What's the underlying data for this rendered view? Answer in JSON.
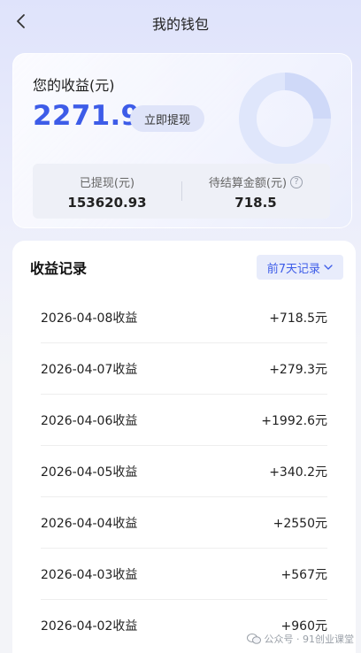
{
  "header": {
    "title": "我的钱包"
  },
  "earnings": {
    "label": "您的收益(元)",
    "amount": "2271.9",
    "withdraw_label": "立即提现",
    "withdrawn_label": "已提现(元)",
    "withdrawn_value": "153620.93",
    "pending_label": "待结算金额(元)",
    "pending_value": "718.5"
  },
  "records": {
    "title": "收益记录",
    "filter_label": "前7天记录",
    "items": [
      {
        "label": "2026-04-08收益",
        "amount": "+718.5元"
      },
      {
        "label": "2026-04-07收益",
        "amount": "+279.3元"
      },
      {
        "label": "2026-04-06收益",
        "amount": "+1992.6元"
      },
      {
        "label": "2026-04-05收益",
        "amount": "+340.2元"
      },
      {
        "label": "2026-04-04收益",
        "amount": "+2550元"
      },
      {
        "label": "2026-04-03收益",
        "amount": "+567元"
      },
      {
        "label": "2026-04-02收益",
        "amount": "+960元"
      }
    ]
  },
  "watermark": {
    "text": "公众号 · 91创业课堂"
  },
  "colors": {
    "accent": "#3d5ce8",
    "accent_bg": "#e8ecfb"
  }
}
